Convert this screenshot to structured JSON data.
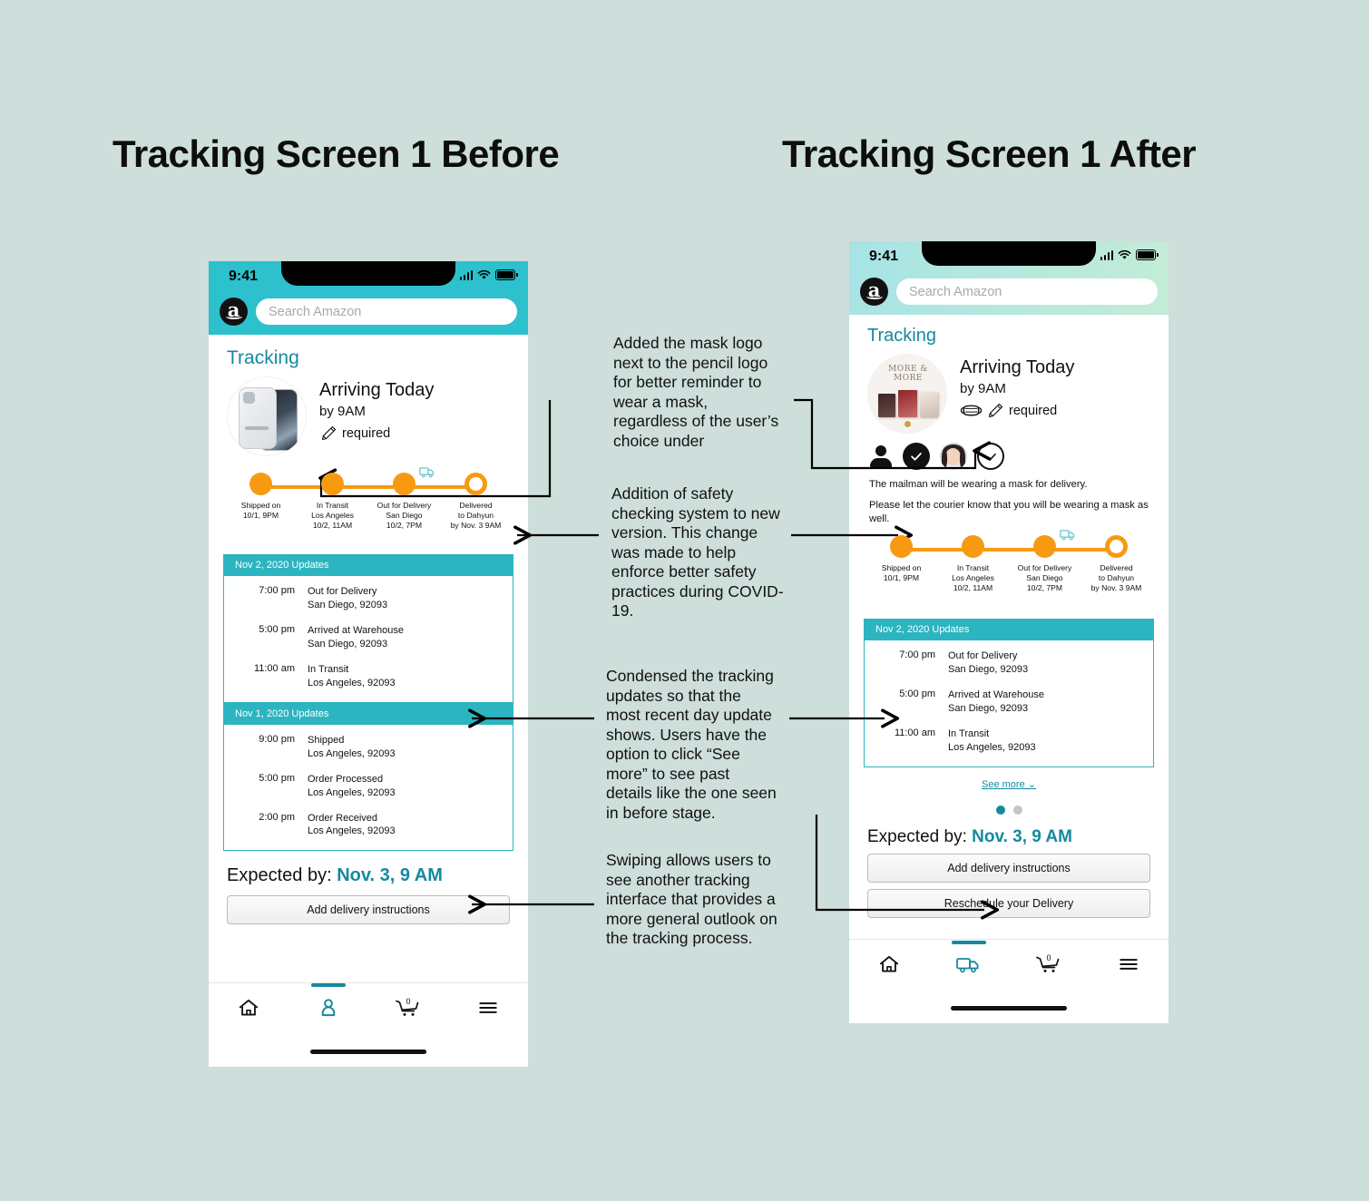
{
  "page": {
    "background_color": "#cddedb",
    "accent_teal": "#1589a0",
    "header_teal": "#2cc1cd",
    "orange": "#f79a12"
  },
  "titles": {
    "before": "Tracking Screen 1 Before",
    "after": "Tracking Screen 1 After"
  },
  "status_bar": {
    "time": "9:41",
    "icons": [
      "signal-bars-icon",
      "wifi-icon",
      "battery-icon"
    ]
  },
  "search": {
    "placeholder": "Search Amazon",
    "logo_letter": "a",
    "logo_name": "amazon-logo"
  },
  "before": {
    "page_title": "Tracking",
    "product": {
      "image_name": "phone-case-product-image",
      "arriving": "Arriving Today",
      "by_time": "by 9AM",
      "signature": "required",
      "icons": [
        "pencil-icon"
      ]
    },
    "tracker": {
      "steps": [
        {
          "state": "done",
          "lines": [
            "Shipped on",
            "10/1, 9PM"
          ]
        },
        {
          "state": "done",
          "lines": [
            "In Transit",
            "Los Angeles",
            "10/2, 11AM"
          ]
        },
        {
          "state": "done",
          "lines": [
            "Out for Delivery",
            "San Diego",
            "10/2, 7PM"
          ]
        },
        {
          "state": "pending",
          "lines": [
            "Delivered",
            "to Dahyun",
            "by Nov. 3 9AM"
          ]
        }
      ],
      "truck_icon": "delivery-truck-icon"
    },
    "updates": [
      {
        "header": "Nov 2, 2020 Updates",
        "rows": [
          {
            "time": "7:00 pm",
            "status": "Out for Delivery",
            "location": "San Diego, 92093"
          },
          {
            "time": "5:00 pm",
            "status": "Arrived at Warehouse",
            "location": "San Diego, 92093"
          },
          {
            "time": "11:00 am",
            "status": "In Transit",
            "location": "Los Angeles, 92093"
          }
        ]
      },
      {
        "header": "Nov 1, 2020 Updates",
        "rows": [
          {
            "time": "9:00 pm",
            "status": "Shipped",
            "location": "Los Angeles, 92093"
          },
          {
            "time": "5:00 pm",
            "status": "Order Processed",
            "location": "Los Angeles, 92093"
          },
          {
            "time": "2:00 pm",
            "status": "Order Received",
            "location": "Los Angeles, 92093"
          }
        ]
      }
    ],
    "expected_label": "Expected by:",
    "expected_value": "Nov. 3, 9 AM",
    "buttons": [
      "Add delivery instructions"
    ],
    "nav": [
      {
        "name": "home-icon",
        "selected": false
      },
      {
        "name": "account-icon",
        "selected": true
      },
      {
        "name": "cart-icon",
        "badge": "0",
        "selected": false
      },
      {
        "name": "menu-icon",
        "selected": false
      }
    ]
  },
  "after": {
    "page_title": "Tracking",
    "product": {
      "image_name": "album-product-image",
      "image_text": "MORE & MORE",
      "arriving": "Arriving Today",
      "by_time": "by 9AM",
      "signature": "required",
      "icons": [
        "face-mask-icon",
        "pencil-icon"
      ]
    },
    "safety": {
      "badges": [
        "person-icon",
        "check-filled-icon",
        "user-avatar",
        "check-outline-icon"
      ],
      "line1": "The mailman will be wearing a mask for delivery.",
      "line2": "Please let the courier know that you will be wearing a mask as well."
    },
    "tracker": {
      "steps": [
        {
          "state": "done",
          "lines": [
            "Shipped on",
            "10/1, 9PM"
          ]
        },
        {
          "state": "done",
          "lines": [
            "In Transit",
            "Los Angeles",
            "10/2, 11AM"
          ]
        },
        {
          "state": "done",
          "lines": [
            "Out for Delivery",
            "San Diego",
            "10/2, 7PM"
          ]
        },
        {
          "state": "pending",
          "lines": [
            "Delivered",
            "to Dahyun",
            "by Nov. 3 9AM"
          ]
        }
      ],
      "truck_icon": "delivery-truck-icon"
    },
    "updates": [
      {
        "header": "Nov 2, 2020 Updates",
        "rows": [
          {
            "time": "7:00 pm",
            "status": "Out for Delivery",
            "location": "San Diego, 92093"
          },
          {
            "time": "5:00 pm",
            "status": "Arrived at Warehouse",
            "location": "San Diego, 92093"
          },
          {
            "time": "11:00 am",
            "status": "In Transit",
            "location": "Los Angeles, 92093"
          }
        ]
      }
    ],
    "see_more": "See more",
    "pager": {
      "count": 2,
      "active_index": 0
    },
    "expected_label": "Expected by:",
    "expected_value": "Nov. 3, 9 AM",
    "buttons": [
      "Add delivery instructions",
      "Reschedule your Delivery"
    ],
    "nav": [
      {
        "name": "home-icon",
        "selected": false
      },
      {
        "name": "truck-icon",
        "selected": true
      },
      {
        "name": "cart-icon",
        "badge": "0",
        "selected": false
      },
      {
        "name": "menu-icon",
        "selected": false
      }
    ]
  },
  "annotations": {
    "a1": "Added the mask logo next to the pencil logo for better reminder to wear a mask, regardless of the user’s choice under",
    "a2": "Addition of safety checking system to new version. This change was made to help enforce better safety practices during COVID-19.",
    "a3": "Condensed the tracking updates so that the most recent day update shows. Users have the option to click “See more” to see past details like the one seen in before stage.",
    "a4": "Swiping allows users to see another tracking interface that provides a more general outlook on the tracking process."
  }
}
